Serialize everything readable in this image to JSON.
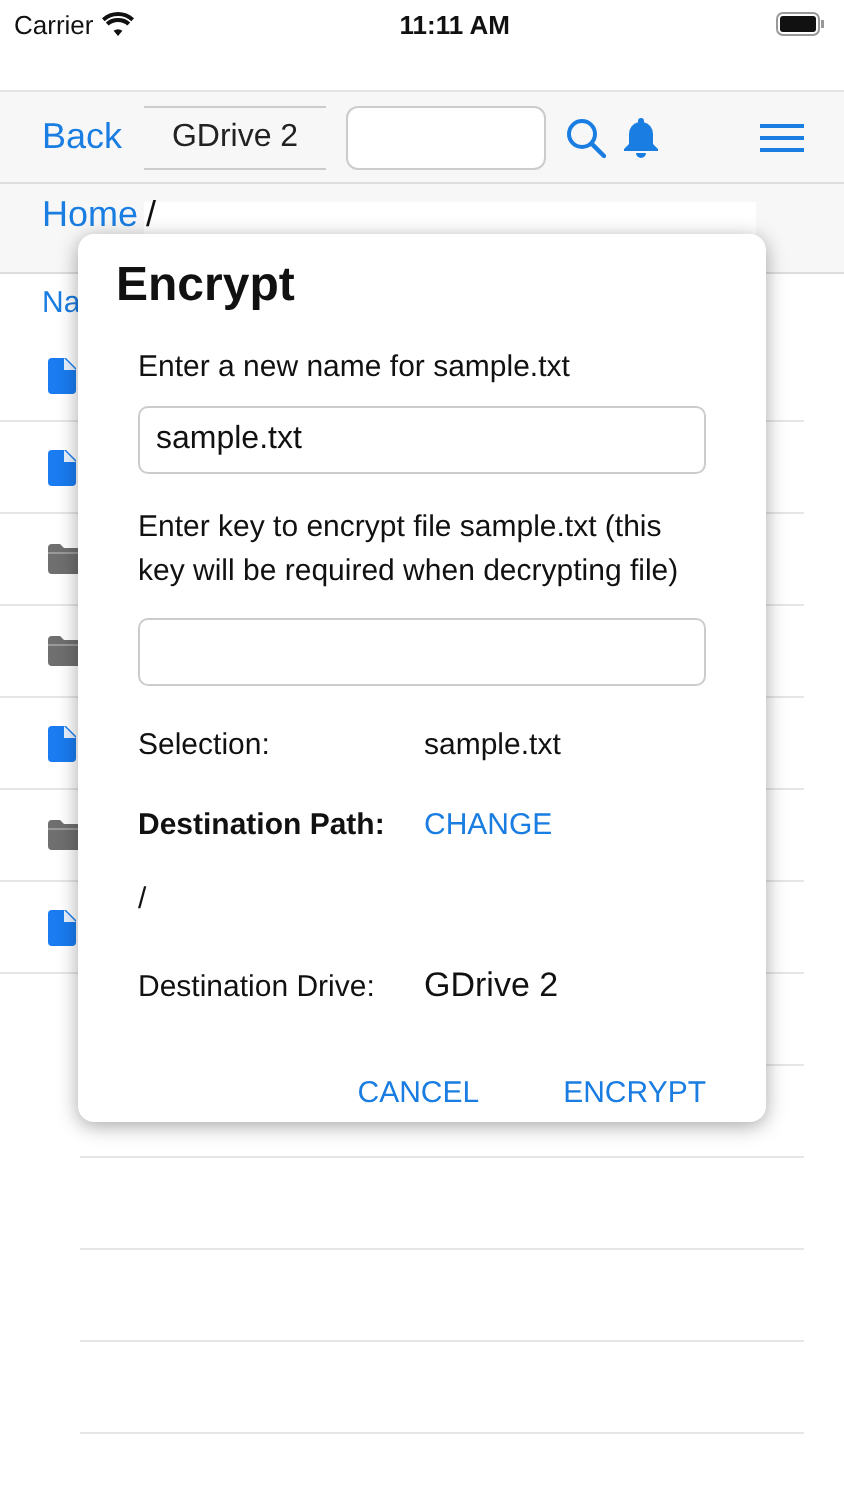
{
  "status_bar": {
    "carrier": "Carrier",
    "time": "11:11 AM"
  },
  "nav_bar": {
    "back": "Back",
    "drive_picker": "GDrive 2"
  },
  "breadcrumb": {
    "home": "Home",
    "separator": "/"
  },
  "file_list": {
    "header": "Na",
    "rows": [
      {
        "kind": "file"
      },
      {
        "kind": "file"
      },
      {
        "kind": "folder"
      },
      {
        "kind": "folder"
      },
      {
        "kind": "file"
      },
      {
        "kind": "folder"
      },
      {
        "kind": "file"
      }
    ]
  },
  "dialog": {
    "title": "Encrypt",
    "name_label": "Enter a new name for sample.txt",
    "name_value": "sample.txt",
    "key_label": "Enter key to encrypt file sample.txt (this key will be required when decrypting file)",
    "selection_label": "Selection:",
    "selection_value": "sample.txt",
    "path_label": "Destination Path:",
    "change": "CHANGE",
    "path_value": "/",
    "drive_label": "Destination Drive:",
    "drive_value": "GDrive 2",
    "buttons": [
      "CANCEL",
      "ENCRYPT"
    ]
  }
}
